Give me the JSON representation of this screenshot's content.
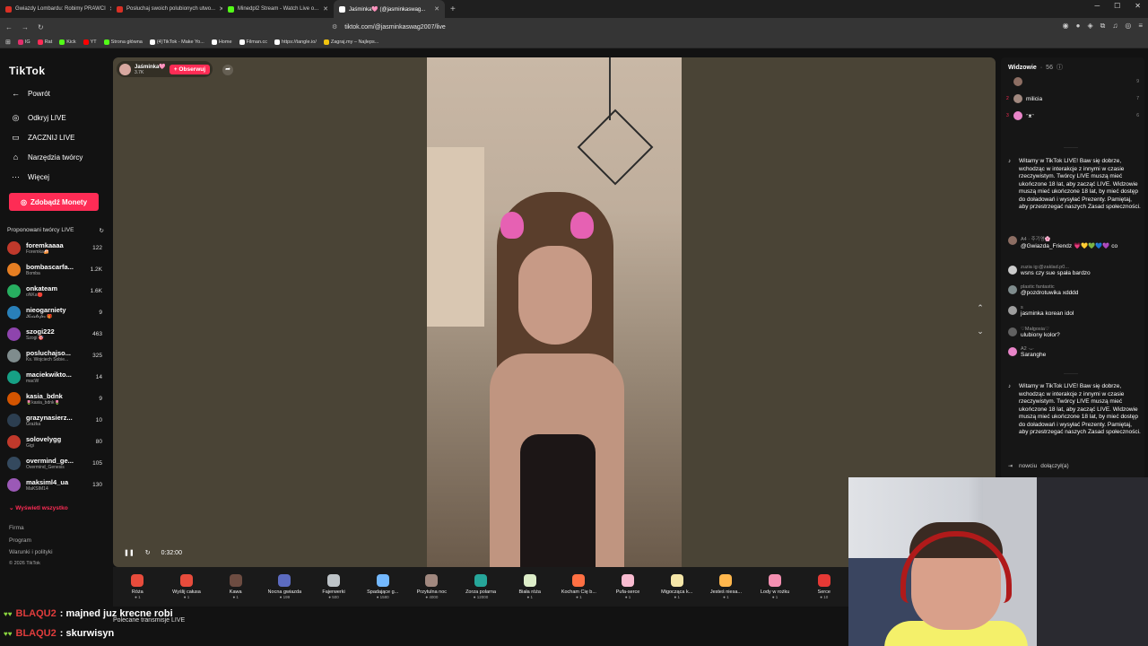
{
  "browser": {
    "tabs": [
      {
        "title": "Gwiazdy Lombardu: Robimy PRAWCI",
        "color": "#d93025"
      },
      {
        "title": "Posłuchaj swoich polubionych utwo...",
        "color": "#d93025"
      },
      {
        "title": "Minedpl2 Stream - Watch Live o...",
        "color": "#53fc18"
      },
      {
        "title": "Jaśminka🩷 (@jasminkaswag...",
        "color": "#ffffff",
        "active": true
      }
    ],
    "url": "tiktok.com/@jasminkaswag2007/live",
    "bookmarks": [
      {
        "label": "IG",
        "color": "#e1306c"
      },
      {
        "label": "Rat",
        "color": "#fe2c55"
      },
      {
        "label": "Kick",
        "color": "#53fc18"
      },
      {
        "label": "YT",
        "color": "#ff0000"
      },
      {
        "label": "Strona główna",
        "color": "#53fc18"
      },
      {
        "label": "(4)TikTok - Make Yo...",
        "color": "#ffffff"
      },
      {
        "label": "Home",
        "color": "#ffffff"
      },
      {
        "label": "Filman.cc",
        "color": "#ffffff"
      },
      {
        "label": "https://tangle.io/",
        "color": "#ffffff"
      },
      {
        "label": "Zagraj.my – Najleps...",
        "color": "#f1c40f"
      }
    ]
  },
  "sidebar": {
    "logo": "TikTok",
    "back": "Powrót",
    "nav": [
      "Odkryj LIVE",
      "ZACZNIJ LIVE",
      "Narzędzia twórcy",
      "Więcej"
    ],
    "coins": "Zdobądź Monety",
    "suggested_title": "Proponowani twórcy LIVE",
    "creators": [
      {
        "name": "foremkaaaa",
        "sub": "Foremka🍰",
        "count": "122",
        "color": "#c0392b"
      },
      {
        "name": "bombascarfa...",
        "sub": "Bomba",
        "count": "1.2K",
        "color": "#e67e22"
      },
      {
        "name": "onkateam",
        "sub": "oNKa🔴",
        "count": "1.6K",
        "color": "#27ae60"
      },
      {
        "name": "nieogarniety",
        "sub": "𝓚𝓻𝓲𝓼𝓽𝓸𝓯𝓮𝓻 🎁",
        "count": "9",
        "color": "#2980b9"
      },
      {
        "name": "szogi222",
        "sub": "Szogi 🎯",
        "count": "463",
        "color": "#8e44ad"
      },
      {
        "name": "posluchajso...",
        "sub": "Ks. Wojciech Sobie...",
        "count": "325",
        "color": "#7f8c8d"
      },
      {
        "name": "maciekwikto...",
        "sub": "macW",
        "count": "14",
        "color": "#16a085"
      },
      {
        "name": "kasia_bdnk",
        "sub": "🌷kasia_bdnk🌷",
        "count": "9",
        "color": "#d35400"
      },
      {
        "name": "grazynasierz...",
        "sub": "Grażka",
        "count": "10",
        "color": "#2c3e50"
      },
      {
        "name": "solovelygg",
        "sub": "Gigi",
        "count": "80",
        "color": "#c0392b"
      },
      {
        "name": "overmind_ge...",
        "sub": "Overmind_Genesis",
        "count": "105",
        "color": "#34495e"
      },
      {
        "name": "maksiml4_ua",
        "sub": "MaKSIM14",
        "count": "130",
        "color": "#9b59b6"
      }
    ],
    "show_all": "Wyświetl wszystko",
    "footer": [
      "Firma",
      "Program",
      "Warunki i polityki",
      "© 2026 TikTok"
    ]
  },
  "stream": {
    "host_name": "Jaśminka🩷",
    "host_likes": "3.7K",
    "follow": "+ Obserwuj",
    "time": "0:32:00"
  },
  "gifts": [
    {
      "name": "Róża",
      "price": "1",
      "color": "#e74c3c"
    },
    {
      "name": "Wyślij całusa",
      "price": "1",
      "color": "#e74c3c"
    },
    {
      "name": "Kawa",
      "price": "1",
      "color": "#6d4c41"
    },
    {
      "name": "Nocna gwiazda",
      "price": "199",
      "color": "#5c6bc0"
    },
    {
      "name": "Fajerwerki",
      "price": "500",
      "color": "#bdc3c7"
    },
    {
      "name": "Spadające g...",
      "price": "1580",
      "color": "#74b9ff"
    },
    {
      "name": "Przytulna noc",
      "price": "4000",
      "color": "#a1887f"
    },
    {
      "name": "Zorza polarna",
      "price": "12000",
      "color": "#26a69a"
    },
    {
      "name": "Biała róża",
      "price": "1",
      "color": "#dcedc8"
    },
    {
      "name": "Kocham Cię b...",
      "price": "1",
      "color": "#ff7043"
    },
    {
      "name": "Pufa-serce",
      "price": "1",
      "color": "#f8bbd0"
    },
    {
      "name": "Migocząca k...",
      "price": "1",
      "color": "#f5e6a8"
    },
    {
      "name": "Jesteś niesa...",
      "price": "1",
      "color": "#ffb74d"
    },
    {
      "name": "Lody w rożku",
      "price": "1",
      "color": "#f48fb1"
    },
    {
      "name": "Serce",
      "price": "10",
      "color": "#e53935"
    }
  ],
  "right": {
    "viewers_title": "Widzowie",
    "viewers_count": "56",
    "viewers": [
      {
        "rank": "",
        "name": "",
        "value": "9",
        "color": "#8d6e63"
      },
      {
        "rank": "2",
        "name": "milicia",
        "value": "7",
        "color": "#a1887f"
      },
      {
        "rank": "3",
        "name": "ᵔᴥᵔ",
        "value": "6",
        "color": "#e884c8"
      }
    ],
    "system_msg": "Witamy w TikTok LIVE! Baw się dobrze, wchodząc w interakcje z innymi w czasie rzeczywistym. Twórcy LIVE muszą mieć ukończone 18 lat, aby zacząć LIVE. Widzowie muszą mieć ukończone 18 lat, by mieć dostęp do doładowań i wysyłać Prezenty. Pamiętaj, aby przestrzegać naszych Zasad społeczności.",
    "messages": [
      {
        "user": "A4 · 주기영🌸",
        "text": "@Gwiazda_Friendz 💗💛💚💙💜 co",
        "color": "#8d6e63"
      },
      {
        "user": "zuzia ig:@zaklad.p0...",
        "text": "wsns czy sue spała bardzo",
        "color": "#cccccc"
      },
      {
        "user": "plastic fantastic",
        "text": "@pozdrotuwika xdddd",
        "color": "#7f8c8d"
      },
      {
        "user": "s",
        "text": "jasminka korean idol",
        "color": "#9e9e9e"
      },
      {
        "user": "♡Małgosia♡",
        "text": "ulubiony kolor?",
        "color": "#616161"
      },
      {
        "user": "A2 ·ᴗ·",
        "text": "Saranghe",
        "color": "#e884c8"
      }
    ],
    "joined_user": "nowciu",
    "joined_text": "dołączył(a)"
  },
  "overlay_chat": [
    {
      "user": "BLAQU2",
      "text": ": majned juz krecne robi"
    },
    {
      "user": "BLAQU2",
      "text": ": skurwisyn"
    }
  ],
  "recommended": "Polecane transmisje LIVE"
}
